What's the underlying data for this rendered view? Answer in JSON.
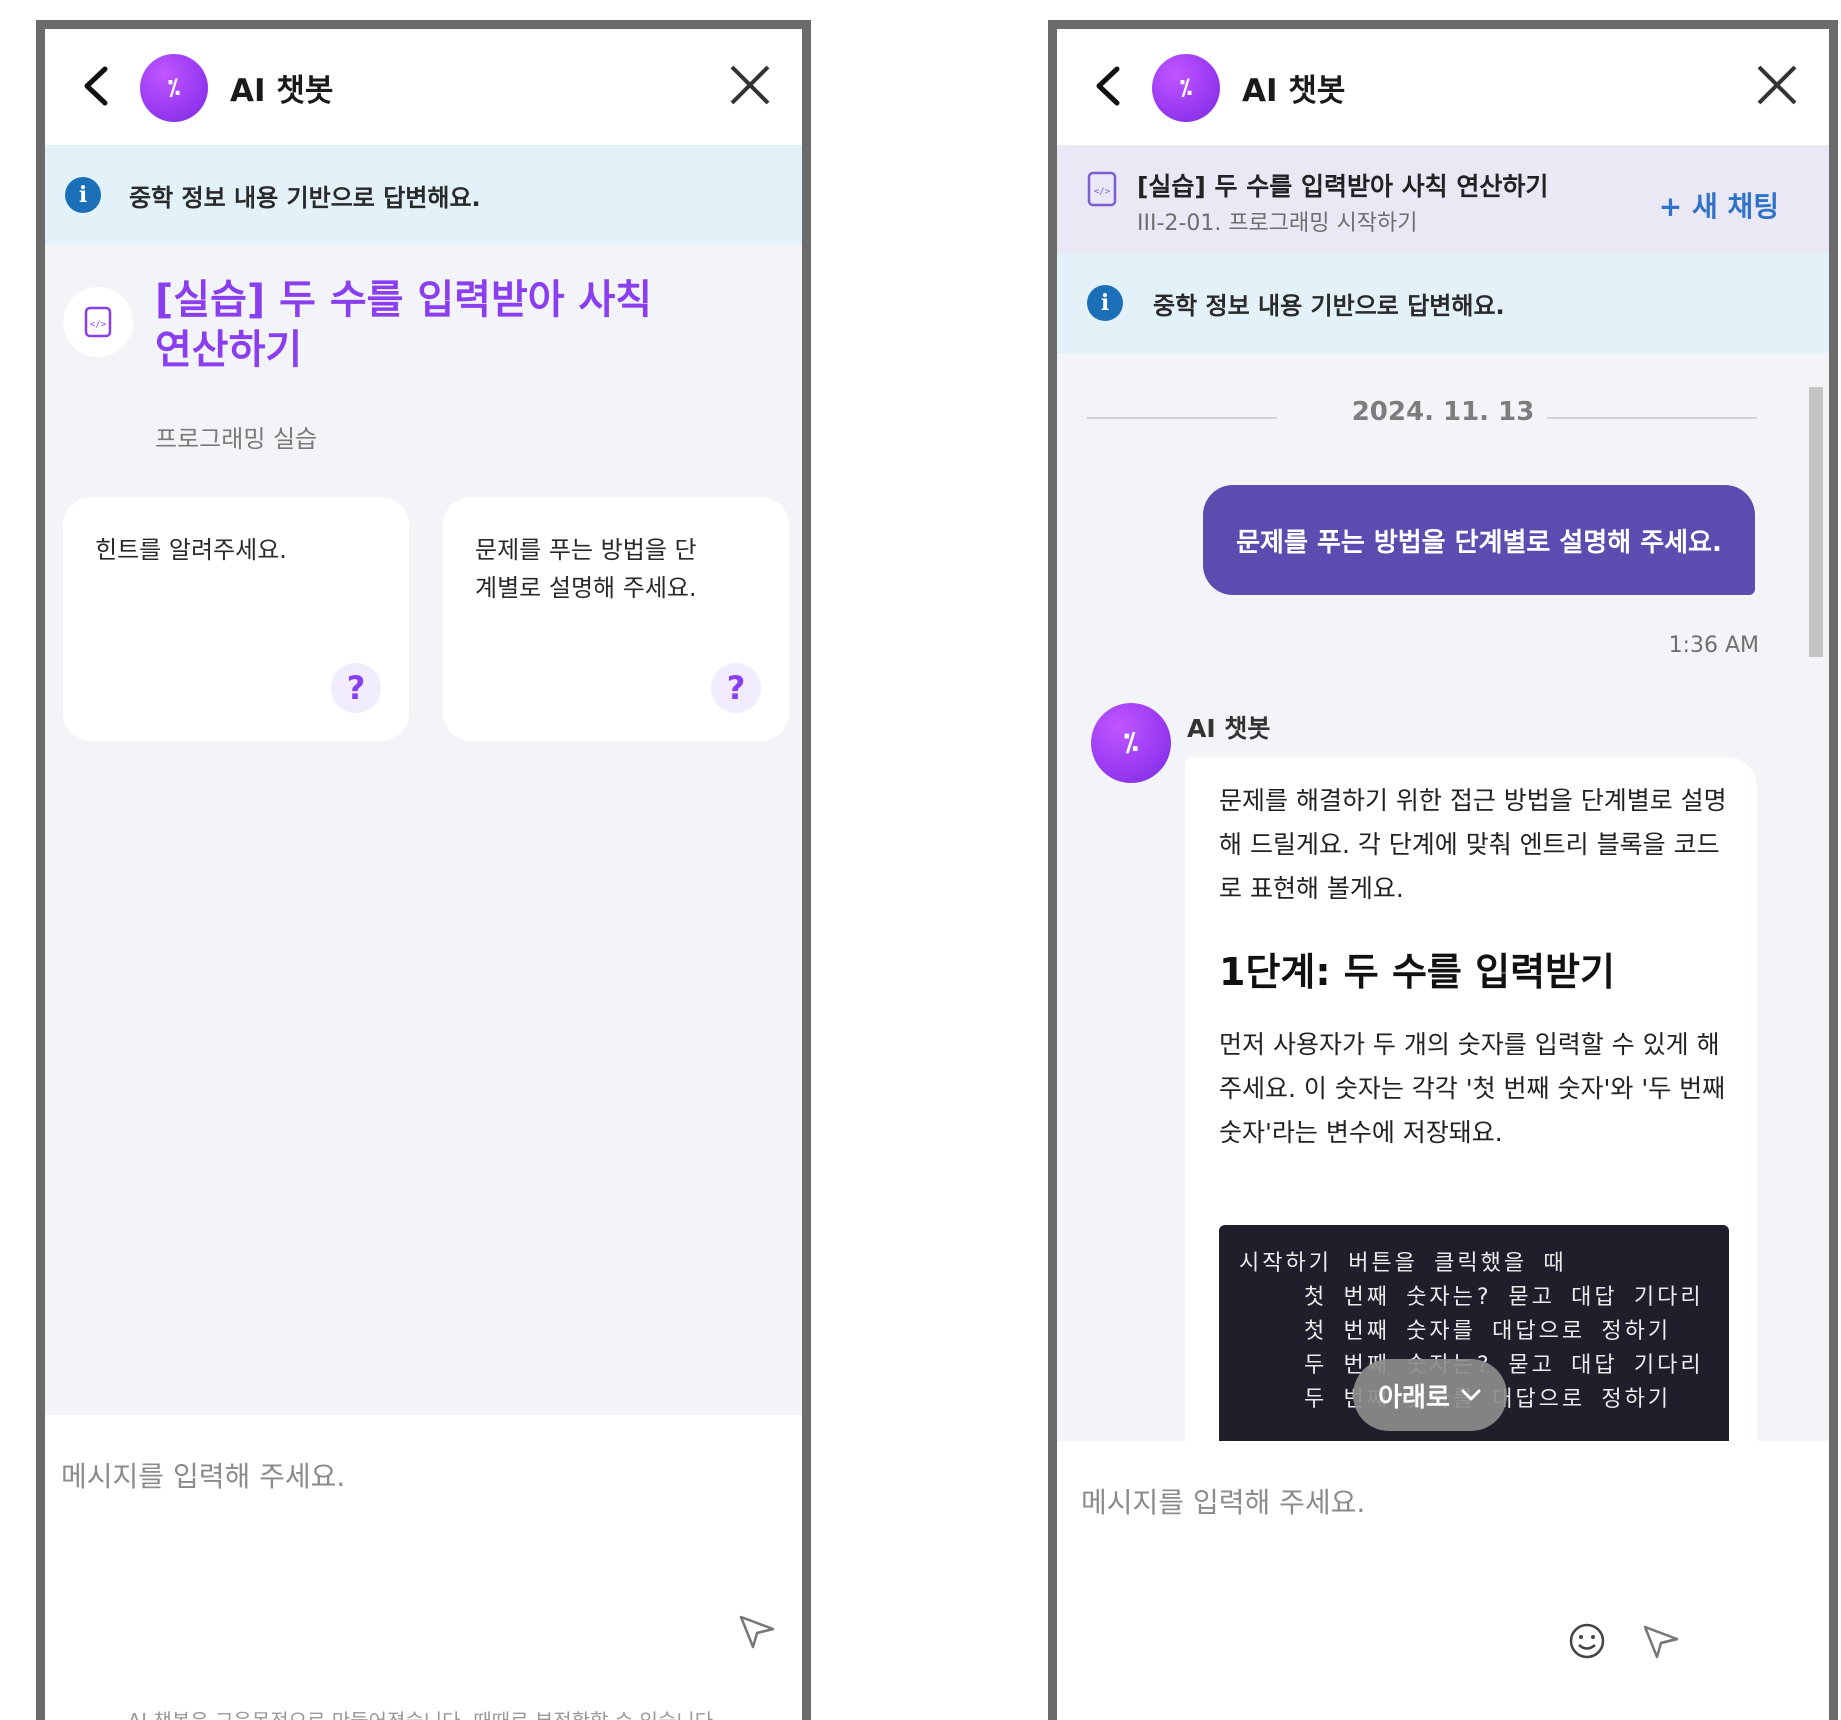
{
  "left": {
    "header": {
      "title": "AI 챗봇",
      "logo_glyph": "⁒"
    },
    "info": {
      "icon_letter": "i",
      "text": "중학 정보 내용 기반으로 답변해요."
    },
    "lesson": {
      "title": "[실습] 두 수를 입력받아 사칙 연산하기",
      "subtitle": "프로그래밍 실습"
    },
    "cards": [
      {
        "text": "힌트를 알려주세요.",
        "icon": "?"
      },
      {
        "text": "문제를 푸는 방법을 단계별로 설명해 주세요.",
        "icon": "?"
      }
    ],
    "input": {
      "placeholder": "메시지를 입력해 주세요."
    },
    "disclaimer": "AI 챗봇은 교육목적으로 만들어졌습니다. 때때로 부정확할 수 있습니다."
  },
  "right": {
    "header": {
      "title": "AI 챗봇",
      "logo_glyph": "⁒"
    },
    "lesson_bar": {
      "title": "[실습] 두 수를 입력받아 사칙 연산하기",
      "subtitle": "III-2-01. 프로그래밍 시작하기",
      "new_chat": "+ 새 채팅"
    },
    "info": {
      "icon_letter": "i",
      "text": "중학 정보 내용 기반으로 답변해요."
    },
    "chat": {
      "date": "2024. 11. 13",
      "user_message": "문제를 푸는 방법을 단계별로 설명해 주세요.",
      "time": "1:36 AM",
      "bot_name": "AI 챗봇",
      "bot_intro": "문제를 해결하기 위한 접근 방법을 단계별로 설명해 드릴게요. 각 단계에 맞춰 엔트리 블록을 코드로 표현해 볼게요.",
      "step_heading": "1단계: 두 수를 입력받기",
      "step_text": "먼저 사용자가 두 개의 숫자를 입력할 수 있게 해주세요. 이 숫자는 각각 '첫 번째 숫자'와 '두 번째 숫자'라는 변수에 저장돼요.",
      "code_lines": [
        "시작하기 버튼을 클릭했을 때",
        "    첫 번째 숫자는? 묻고 대답 기다리",
        "    첫 번째 숫자를 대답으로 정하기",
        "    두 번째 숫자는? 묻고 대답 기다리",
        "    두 번째 숫자를 대답으로 정하기"
      ],
      "scroll_down_label": "아래로"
    },
    "input": {
      "placeholder": "메시지를 입력해 주세요."
    }
  }
}
